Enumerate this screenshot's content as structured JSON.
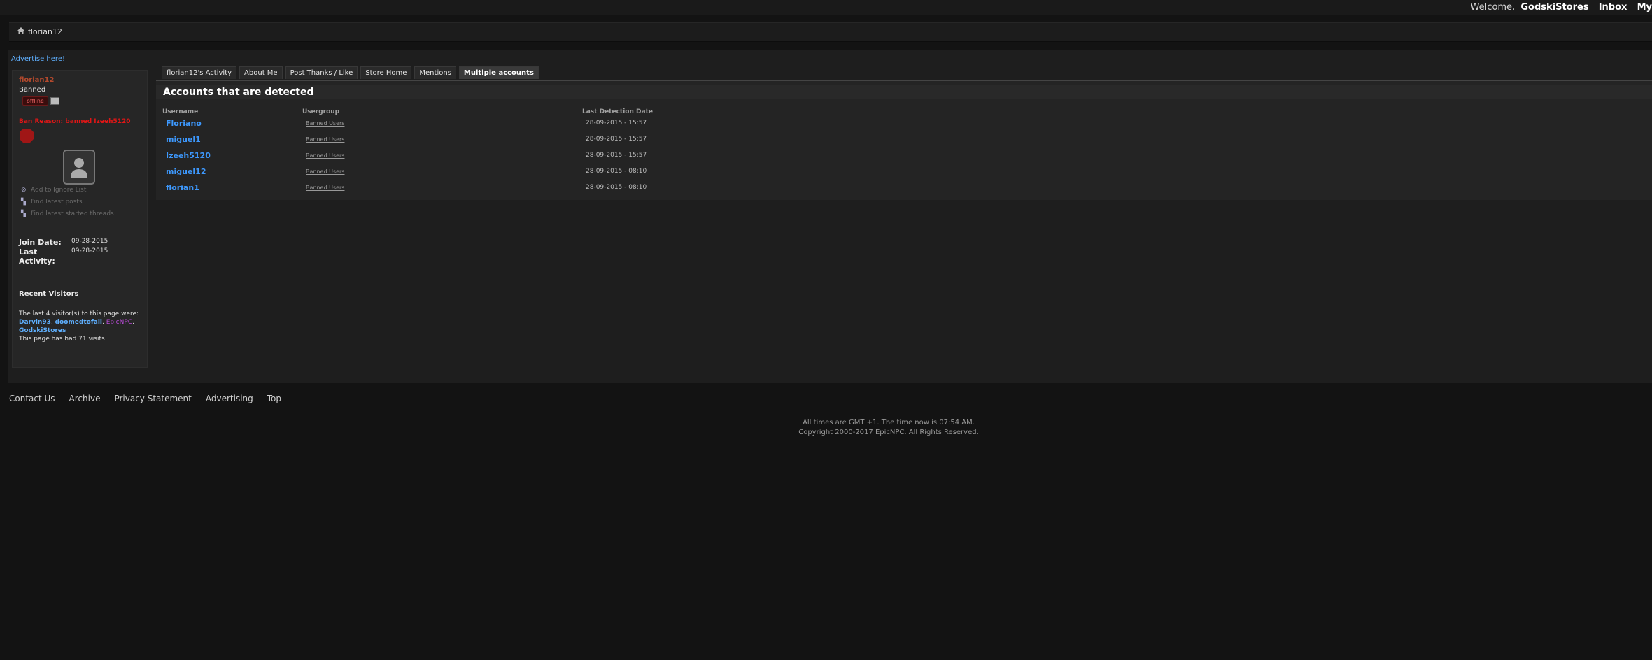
{
  "topbar": {
    "welcome": "Welcome,",
    "user": "GodskiStores",
    "inbox": "Inbox",
    "my": "My"
  },
  "breadcrumb": {
    "current": "florian12"
  },
  "advertise": "Advertise here!",
  "sidebar": {
    "username": "florian12",
    "status": "Banned",
    "online_badge": "offline",
    "ban_reason": "Ban Reason: banned Izeeh5120",
    "links": [
      "Add to Ignore List",
      "Find latest posts",
      "Find latest started threads"
    ],
    "join_date_label": "Join Date:",
    "join_date": "09-28-2015",
    "last_activity_label": "Last Activity:",
    "last_activity": "09-28-2015",
    "recent_visitors_title": "Recent Visitors",
    "recent_visitors_intro": "The last 4 visitor(s) to this page were:",
    "visitors": [
      "Darvin93",
      "doomedtofail",
      "EpicNPC",
      "GodskiStores"
    ],
    "visits_text": "This page has had 71 visits"
  },
  "tabs": [
    "florian12's Activity",
    "About Me",
    "Post Thanks / Like",
    "Store Home",
    "Mentions",
    "Multiple accounts"
  ],
  "panel": {
    "title": "Accounts that are detected",
    "columns": [
      "Username",
      "Usergroup",
      "Last Detection Date"
    ],
    "rows": [
      {
        "username": "Floriano",
        "group": "Banned Users",
        "date": "28-09-2015 - 15:57"
      },
      {
        "username": "miguel1",
        "group": "Banned Users",
        "date": "28-09-2015 - 15:57"
      },
      {
        "username": "Izeeh5120",
        "group": "Banned Users",
        "date": "28-09-2015 - 15:57"
      },
      {
        "username": "miguel12",
        "group": "Banned Users",
        "date": "28-09-2015 - 08:10"
      },
      {
        "username": "florian1",
        "group": "Banned Users",
        "date": "28-09-2015 - 08:10"
      }
    ]
  },
  "footer": {
    "links": [
      "Contact Us",
      "Archive",
      "Privacy Statement",
      "Advertising",
      "Top"
    ],
    "time_text": "All times are GMT +1. The time now is 07:54 AM.",
    "copyright": "Copyright 2000-2017 EpicNPC. All Rights Reserved."
  }
}
